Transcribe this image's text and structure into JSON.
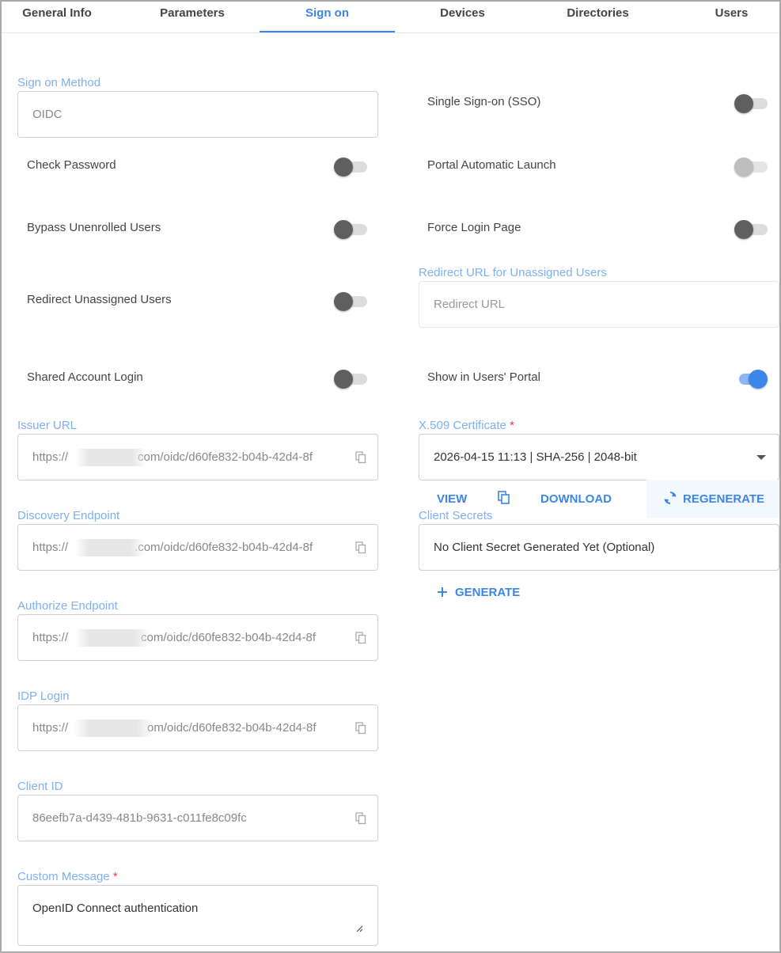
{
  "tabs": [
    {
      "label": "General Info"
    },
    {
      "label": "Parameters"
    },
    {
      "label": "Sign on"
    },
    {
      "label": "Devices"
    },
    {
      "label": "Directories"
    },
    {
      "label": "Users"
    }
  ],
  "sign_on_method": {
    "label": "Sign on Method",
    "value": "OIDC"
  },
  "toggles": {
    "sso": {
      "label": "Single Sign-on (SSO)",
      "on": false
    },
    "check_password": {
      "label": "Check Password",
      "on": false
    },
    "portal_auto_launch": {
      "label": "Portal Automatic Launch",
      "on": false,
      "disabled": true
    },
    "bypass_unenrolled": {
      "label": "Bypass Unenrolled Users",
      "on": false
    },
    "force_login": {
      "label": "Force Login Page",
      "on": false
    },
    "redirect_unassigned": {
      "label": "Redirect Unassigned Users",
      "on": false
    },
    "shared_account": {
      "label": "Shared Account Login",
      "on": false
    },
    "show_in_portal": {
      "label": "Show in Users' Portal",
      "on": true
    }
  },
  "redirect_url": {
    "label": "Redirect URL for Unassigned Users",
    "placeholder": "Redirect URL"
  },
  "issuer_url": {
    "label": "Issuer URL",
    "prefix": "https://",
    "suffix": "com/oidc/d60fe832-b04b-42d4-8f"
  },
  "discovery_endpoint": {
    "label": "Discovery Endpoint",
    "prefix": "https://",
    "suffix": ".com/oidc/d60fe832-b04b-42d4-8f"
  },
  "authorize_endpoint": {
    "label": "Authorize Endpoint",
    "prefix": "https://",
    "suffix": "com/oidc/d60fe832-b04b-42d4-8f"
  },
  "idp_login": {
    "label": "IDP Login",
    "prefix": "https://",
    "suffix": "om/oidc/d60fe832-b04b-42d4-8f"
  },
  "client_id": {
    "label": "Client ID",
    "value": "86eefb7a-d439-481b-9631-c011fe8c09fc"
  },
  "custom_message": {
    "label": "Custom Message",
    "required": "*",
    "value": "OpenID Connect authentication"
  },
  "certificate": {
    "label": "X.509 Certificate",
    "required": "*",
    "value": "2026-04-15 11:13 | SHA-256 | 2048-bit",
    "view": "VIEW",
    "download": "DOWNLOAD",
    "regenerate": "REGENERATE"
  },
  "client_secrets": {
    "label": "Client Secrets",
    "value": "No Client Secret Generated Yet (Optional)",
    "generate": "GENERATE"
  },
  "colors": {
    "accent": "#3b86e8",
    "label": "#7fb0ef",
    "required": "#e23b3b"
  },
  "icons": [
    "copy-icon",
    "refresh-icon",
    "plus-icon",
    "dropdown-caret-icon",
    "resize-handle-icon"
  ]
}
